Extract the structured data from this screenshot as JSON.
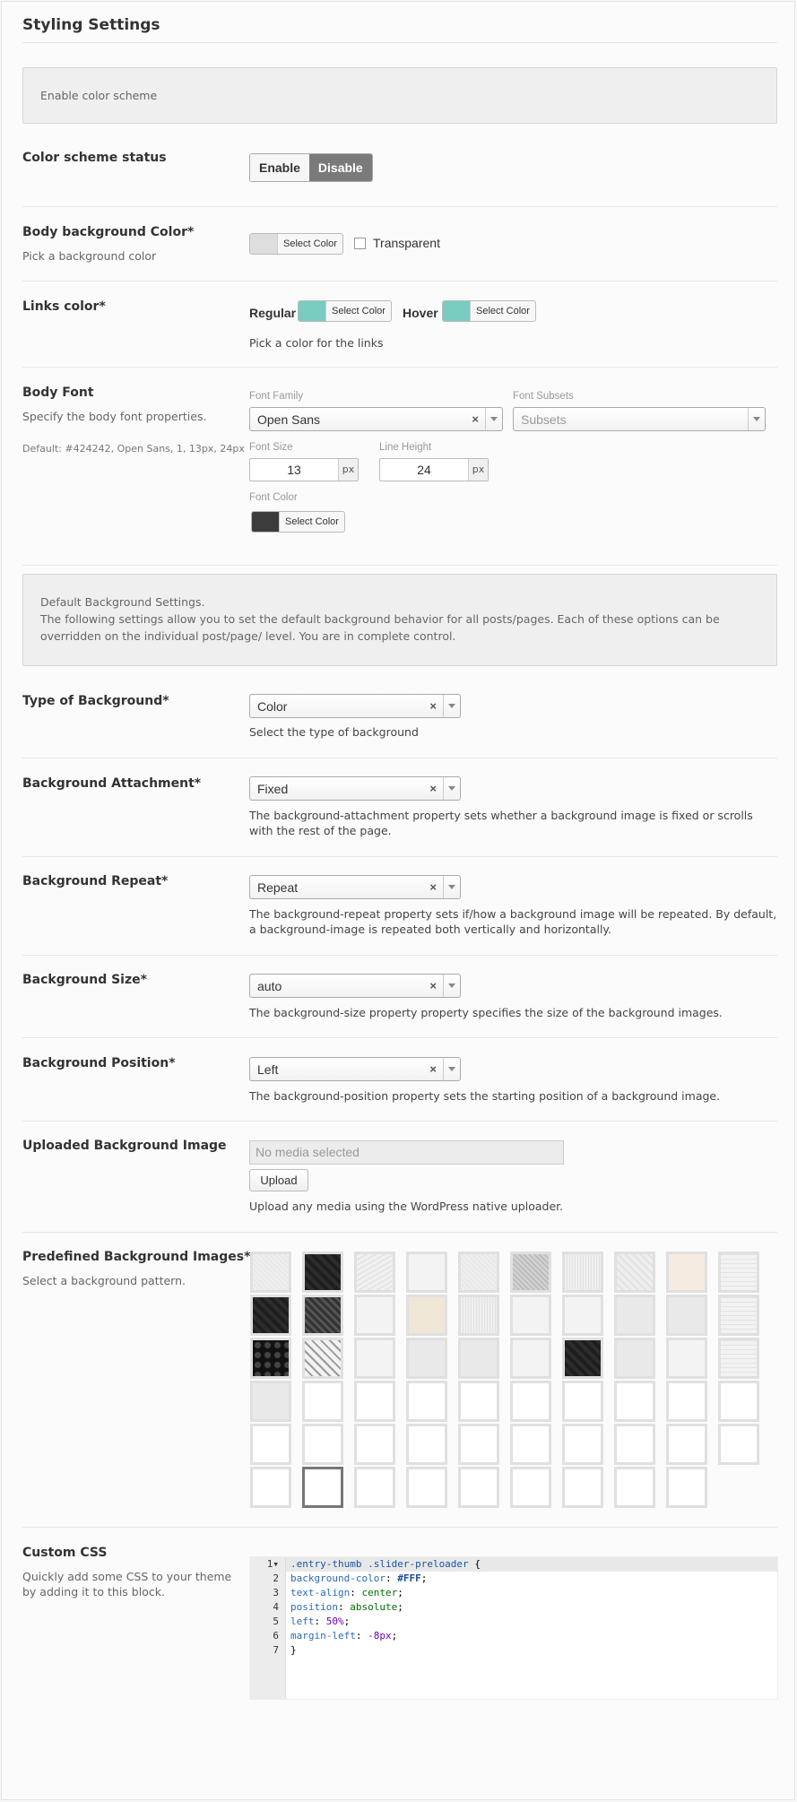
{
  "page": {
    "title": "Styling Settings"
  },
  "notice_color_scheme": "Enable color scheme",
  "color_scheme_status": {
    "label": "Color scheme status",
    "options": [
      "Enable",
      "Disable"
    ],
    "selected": "Disable"
  },
  "body_bg_color": {
    "label": "Body background Color*",
    "desc": "Pick a background color",
    "swatch": "#dedede",
    "picker_label": "Select Color",
    "transparent_label": "Transparent",
    "transparent_checked": false
  },
  "links_color": {
    "label": "Links color*",
    "regular_label": "Regular",
    "regular_swatch": "#78cdbf",
    "hover_label": "Hover",
    "hover_swatch": "#78cdbf",
    "picker_label": "Select Color",
    "help": "Pick a color for the links"
  },
  "body_font": {
    "label": "Body Font",
    "desc": "Specify the body font properties.",
    "default": "Default: #424242, Open Sans, 1, 13px, 24px",
    "family_caption": "Font Family",
    "family_value": "Open Sans",
    "subsets_caption": "Font Subsets",
    "subsets_placeholder": "Subsets",
    "size_caption": "Font Size",
    "size_value": "13",
    "size_unit": "px",
    "line_height_caption": "Line Height",
    "line_height_value": "24",
    "line_height_unit": "px",
    "color_caption": "Font Color",
    "color_swatch": "#3c3c3c",
    "color_picker_label": "Select Color"
  },
  "bg_notice": {
    "title": "Default Background Settings.",
    "text": "The following settings allow you to set the default background behavior for all posts/pages. Each of these options can be overridden on the individual post/page/ level. You are in complete control."
  },
  "bg_type": {
    "label": "Type of Background*",
    "value": "Color",
    "help": "Select the type of background"
  },
  "bg_attachment": {
    "label": "Background Attachment*",
    "value": "Fixed",
    "help": "The background-attachment property sets whether a background image is fixed or scrolls with the rest of the page."
  },
  "bg_repeat": {
    "label": "Background Repeat*",
    "value": "Repeat",
    "help": "The background-repeat property sets if/how a background image will be repeated. By default, a background-image is repeated both vertically and horizontally."
  },
  "bg_size": {
    "label": "Background Size*",
    "value": "auto",
    "help": "The background-size property property specifies the size of the background images."
  },
  "bg_position": {
    "label": "Background Position*",
    "value": "Left",
    "help": "The background-position property sets the starting position of a background image."
  },
  "uploaded_bg": {
    "label": "Uploaded Background Image",
    "placeholder": "No media selected",
    "upload_label": "Upload",
    "help": "Upload any media using the WordPress native uploader."
  },
  "predefined_bg": {
    "label": "Predefined Background Images*",
    "desc": "Select a background pattern.",
    "selected_index": "1-5",
    "columns": [
      [
        "light-noise",
        "dark-diamond",
        "black-dots",
        "light-gray",
        "empty",
        "empty"
      ],
      [
        "dark-diamond",
        "dark-weave",
        "lattice",
        "empty",
        "empty",
        "selected-empty"
      ],
      [
        "crumpled",
        "light-plain",
        "light-plain",
        "empty",
        "empty",
        "empty"
      ],
      [
        "light-plain",
        "beige",
        "light-gray",
        "empty",
        "empty",
        "empty"
      ],
      [
        "light-noise",
        "light-lines",
        "light-gray",
        "empty",
        "empty",
        "empty"
      ],
      [
        "gray-mesh",
        "light-plain",
        "light-plain",
        "empty",
        "empty",
        "empty"
      ],
      [
        "light-lines",
        "light-plain",
        "dark-diamond",
        "empty",
        "empty",
        "empty"
      ],
      [
        "light-diamond",
        "light-gray",
        "light-gray",
        "empty",
        "empty",
        "empty"
      ],
      [
        "peach",
        "light-gray",
        "light-plain",
        "empty",
        "empty",
        "empty"
      ],
      [
        "light-grid",
        "light-grid",
        "light-grid",
        "empty",
        "empty"
      ]
    ]
  },
  "custom_css": {
    "label": "Custom CSS",
    "desc": "Quickly add some CSS to your theme by adding it to this block.",
    "lines": [
      ".entry-thumb .slider-preloader {",
      "background-color: #FFF;",
      "text-align: center;",
      "position: absolute;",
      "left: 50%;",
      "margin-left: -8px;",
      "}"
    ],
    "line_numbers": [
      "1",
      "2",
      "3",
      "4",
      "5",
      "6",
      "7"
    ]
  }
}
